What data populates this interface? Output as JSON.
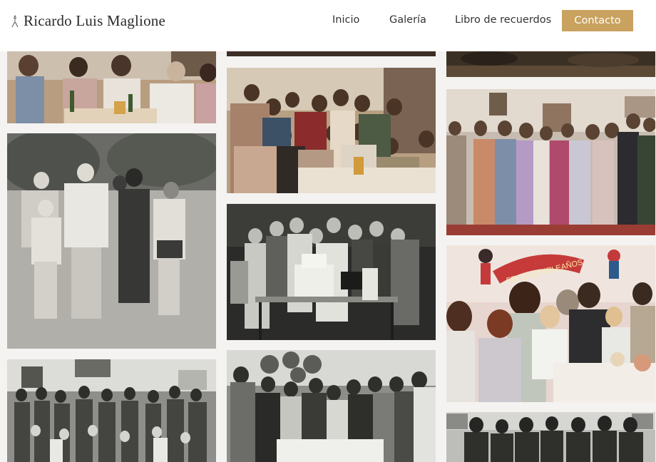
{
  "header": {
    "brand_name": "Ricardo Luis Maglione",
    "brand_icon": "candle-icon",
    "nav": [
      {
        "label": "Inicio"
      },
      {
        "label": "Galería"
      },
      {
        "label": "Libro de recuerdos"
      }
    ],
    "cta_label": "Contacto",
    "accent_color": "#c9a25f"
  },
  "gallery": {
    "columns": 3,
    "photos": [
      {
        "tone": "color-warm",
        "subject": "family-dinner-table"
      },
      {
        "tone": "black-and-white",
        "subject": "family-outdoors"
      },
      {
        "tone": "black-and-white",
        "subject": "large-family-group"
      },
      {
        "tone": "dark",
        "subject": "photo-cropped-top"
      },
      {
        "tone": "color-warm",
        "subject": "family-gathering-table"
      },
      {
        "tone": "black-and-white",
        "subject": "birthday-cake-table"
      },
      {
        "tone": "black-and-white",
        "subject": "birthday-party-balloons"
      },
      {
        "tone": "dark",
        "subject": "photo-cropped-top"
      },
      {
        "tone": "color",
        "subject": "family-standing-group"
      },
      {
        "tone": "color",
        "subject": "birthday-party-children"
      },
      {
        "tone": "black-and-white",
        "subject": "formal-group"
      }
    ],
    "banner_text": "FELIZ CUMPLEAÑOS"
  }
}
